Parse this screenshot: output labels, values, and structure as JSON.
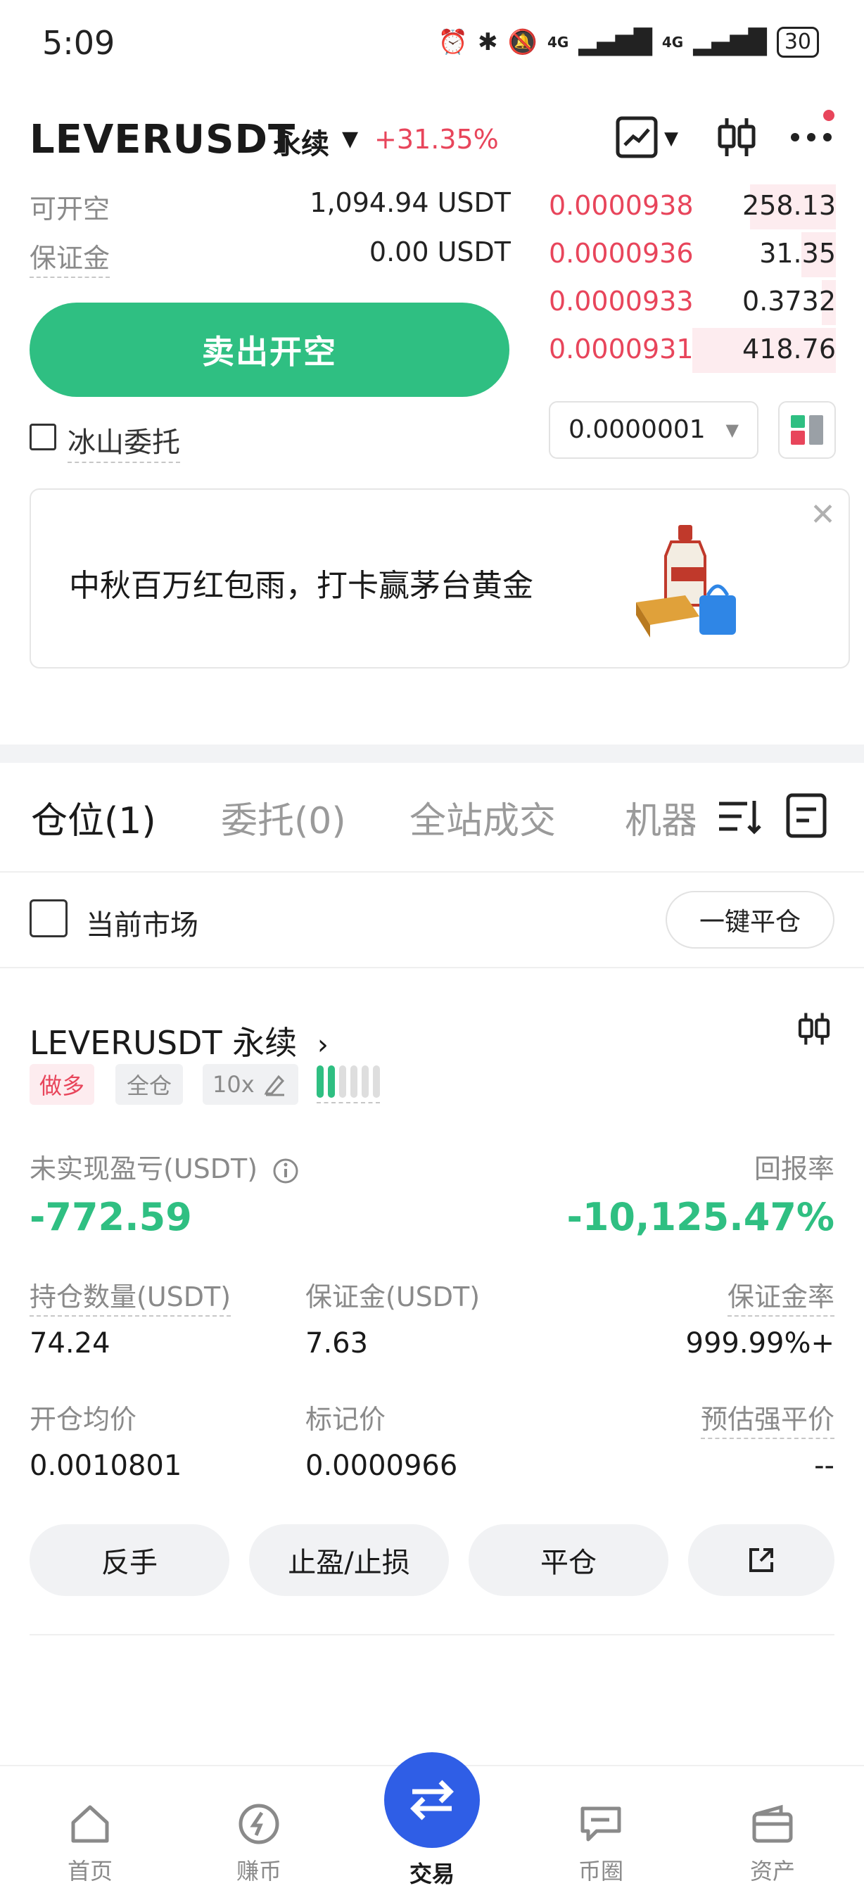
{
  "status_bar": {
    "time": "5:09",
    "signal_1": "4G",
    "signal_2": "4G",
    "battery": "30"
  },
  "header": {
    "pair": "LEVERUSDT",
    "contract_type": "永续",
    "caret": "▼",
    "change": "+31.35%"
  },
  "order_panel": {
    "available_label": "可开空",
    "available_value": "1,094.94 USDT",
    "margin_label": "保证金",
    "margin_value": "0.00 USDT",
    "sell_button": "卖出开空",
    "iceberg_label": "冰山委托"
  },
  "order_book": {
    "asks": [
      {
        "price": "0.0000938",
        "qty": "258.13",
        "depth": 0.3
      },
      {
        "price": "0.0000936",
        "qty": "31.35",
        "depth": 0.12
      },
      {
        "price": "0.0000933",
        "qty": "0.3732",
        "depth": 0.05
      },
      {
        "price": "0.0000931",
        "qty": "418.76",
        "depth": 0.5
      }
    ],
    "precision": "0.0000001",
    "colors": {
      "ask": "#e8455b",
      "bid": "#2fbf82"
    }
  },
  "banner": {
    "text": "中秋百万红包雨，打卡赢茅台黄金",
    "close": "✕"
  },
  "tabs": {
    "positions": "仓位(1)",
    "orders": "委托(0)",
    "trades": "全站成交",
    "bots": "机器"
  },
  "filter": {
    "current_market": "当前市场",
    "close_all": "一键平仓"
  },
  "position": {
    "title": "LEVERUSDT 永续",
    "tag_side": "做多",
    "tag_mode": "全仓",
    "tag_leverage": "10x",
    "risk_level": 2,
    "risk_total": 6,
    "pnl_label": "未实现盈亏(USDT)",
    "pnl_value": "-772.59",
    "roi_label": "回报率",
    "roi_value": "-10,125.47%",
    "size_label": "持仓数量(USDT)",
    "size_value": "74.24",
    "margin_label": "保证金(USDT)",
    "margin_value": "7.63",
    "margin_ratio_label": "保证金率",
    "margin_ratio_value": "999.99%+",
    "entry_label": "开仓均价",
    "entry_value": "0.0010801",
    "mark_label": "标记价",
    "mark_value": "0.0000966",
    "liq_label": "预估强平价",
    "liq_value": "--",
    "actions": {
      "reverse": "反手",
      "tpsl": "止盈/止损",
      "close": "平仓"
    }
  },
  "bottom_nav": {
    "home": "首页",
    "earn": "赚币",
    "trade": "交易",
    "community": "币圈",
    "assets": "资产"
  }
}
